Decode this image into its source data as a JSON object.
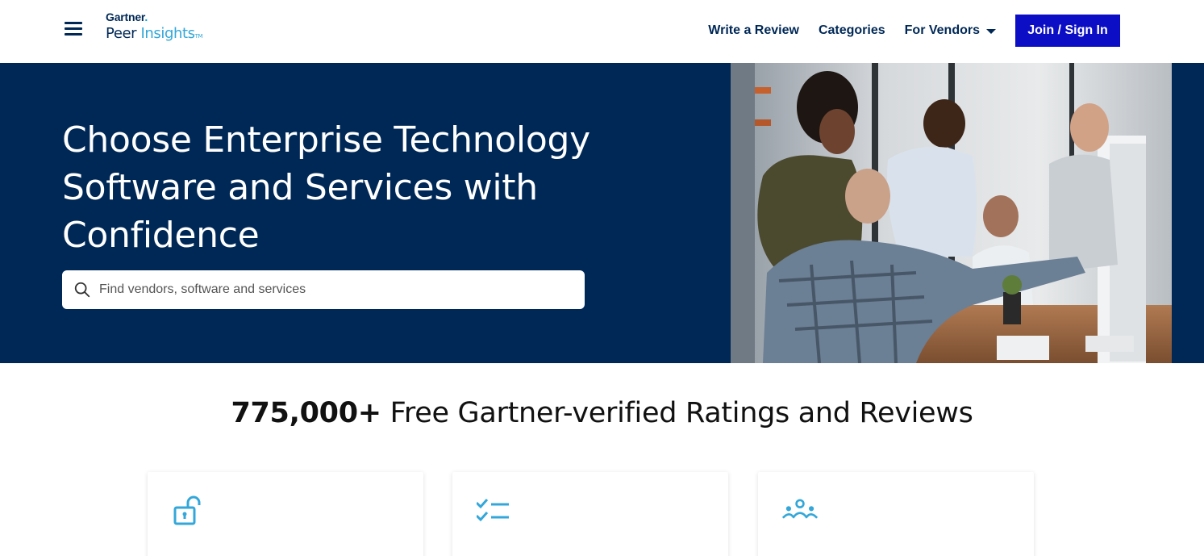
{
  "header": {
    "logo": {
      "brand": "Gartner",
      "product_peer": "Peer",
      "product_insights": "Insights",
      "tm": "TM"
    },
    "menu_icon": "hamburger-icon",
    "nav": {
      "write_review": "Write a Review",
      "categories": "Categories",
      "for_vendors": "For Vendors",
      "join": "Join / Sign In"
    }
  },
  "hero": {
    "title": "Choose Enterprise Technology Software and Services with Confidence",
    "search": {
      "placeholder": "Find vendors, software and services",
      "icon": "search-icon"
    },
    "image": "photo of colleagues gathered around a computer monitor"
  },
  "stats": {
    "count": "775,000+",
    "text": "Free Gartner-verified Ratings and Reviews"
  },
  "cards": [
    {
      "icon": "unlock-icon"
    },
    {
      "icon": "checklist-icon"
    },
    {
      "icon": "community-icon"
    }
  ],
  "colors": {
    "navy": "#002856",
    "accent_blue": "#0c0ec6",
    "light_blue": "#33a7d9"
  }
}
